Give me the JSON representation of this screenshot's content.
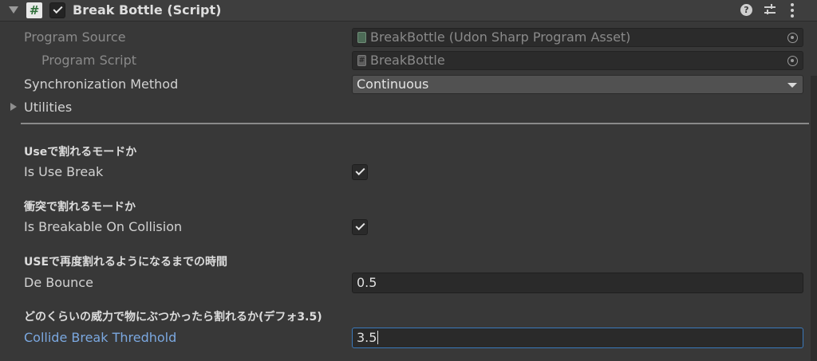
{
  "component": {
    "title": "Break Bottle (Script)",
    "icons": [
      "foldout-arrow-icon",
      "csharp-script-icon",
      "checkmark-icon",
      "help-icon",
      "preset-sliders-icon",
      "kebab-menu-icon"
    ]
  },
  "program_source": {
    "label": "Program Source",
    "value": "BreakBottle (Udon Sharp Program Asset)"
  },
  "program_script": {
    "label": "Program Script",
    "value": "BreakBottle"
  },
  "sync_method": {
    "label": "Synchronization Method",
    "value": "Continuous"
  },
  "utilities": {
    "label": "Utilities"
  },
  "fields": [
    {
      "header": "Useで割れるモードか",
      "label": "Is Use Break",
      "type": "checkbox",
      "checked": true
    },
    {
      "header": "衝突で割れるモードか",
      "label": "Is Breakable On Collision",
      "type": "checkbox",
      "checked": true
    },
    {
      "header": "USEで再度割れるようになるまでの時間",
      "label": "De Bounce",
      "type": "number",
      "value": "0.5"
    },
    {
      "header": "どのくらいの威力で物にぶつかったら割れるか(デフォ3.5)",
      "label": "Collide Break Thredhold",
      "type": "number",
      "value": "3.5",
      "focused": true
    }
  ],
  "colors": {
    "background": "#383838",
    "focus_accent": "#3a79bb",
    "active_label": "#7ba8e0"
  }
}
